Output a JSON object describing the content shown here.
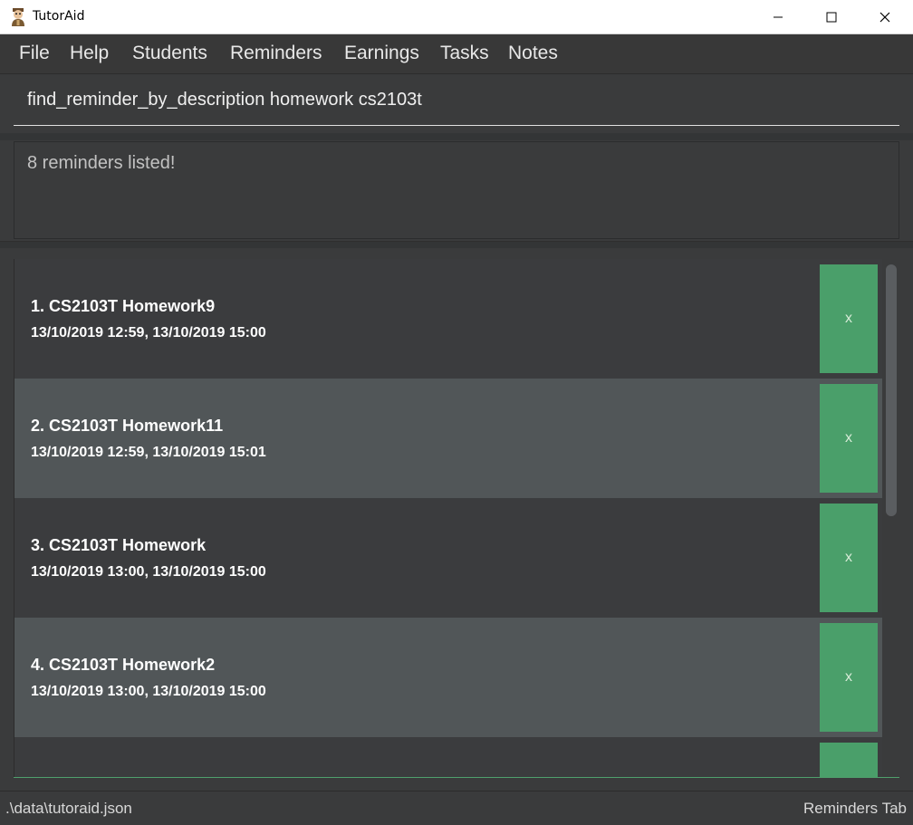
{
  "window": {
    "title": "TutorAid",
    "icon": "tutor-avatar-icon"
  },
  "menu": {
    "items": [
      "File",
      "Help",
      "Students",
      "Reminders",
      "Earnings",
      "Tasks",
      "Notes"
    ]
  },
  "command": {
    "value": "find_reminder_by_description homework cs2103t"
  },
  "result": {
    "text": "8 reminders listed!"
  },
  "reminders": [
    {
      "title": "1.  CS2103T Homework9",
      "times": "13/10/2019 12:59, 13/10/2019 15:00",
      "delete_label": "x"
    },
    {
      "title": "2.  CS2103T Homework11",
      "times": "13/10/2019 12:59, 13/10/2019 15:01",
      "delete_label": "x"
    },
    {
      "title": "3.  CS2103T Homework",
      "times": "13/10/2019 13:00, 13/10/2019 15:00",
      "delete_label": "x"
    },
    {
      "title": "4.  CS2103T Homework2",
      "times": "13/10/2019 13:00, 13/10/2019 15:00",
      "delete_label": "x"
    }
  ],
  "status": {
    "file_path": ".\\data\\tutoraid.json",
    "current_tab": "Reminders Tab"
  },
  "colors": {
    "accent_green": "#4a9f6a",
    "background": "#3a3b3c",
    "row_light": "#515658"
  }
}
